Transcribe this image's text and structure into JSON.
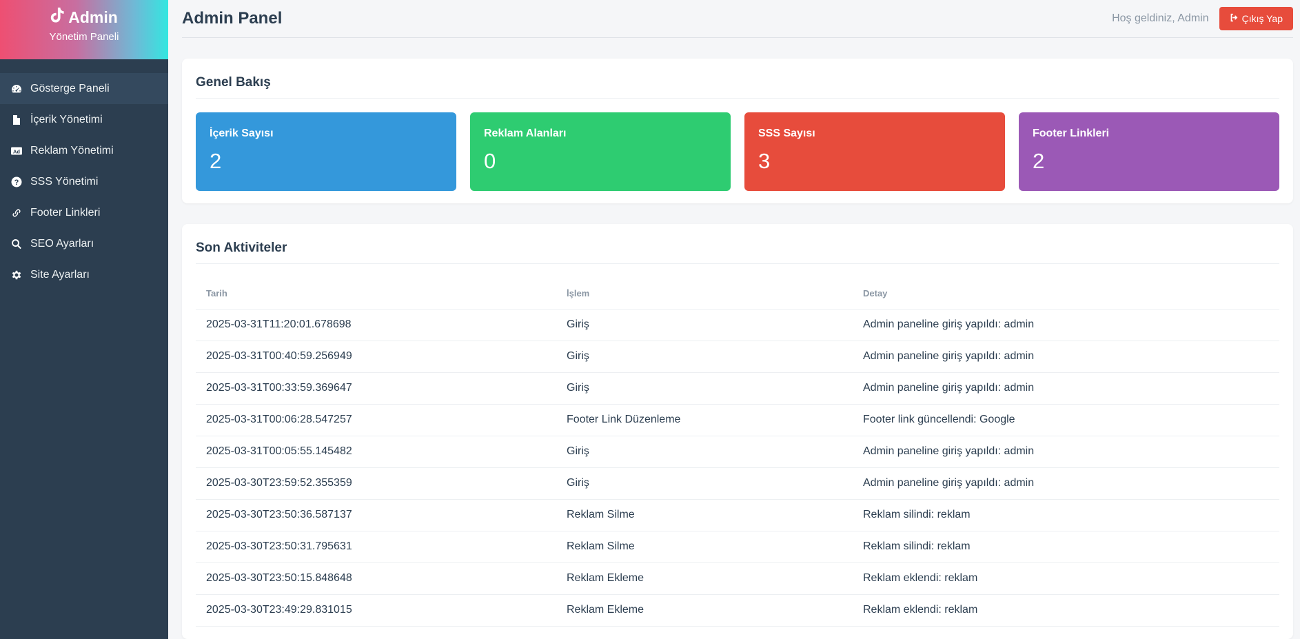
{
  "sidebar": {
    "brand_title": "Admin",
    "brand_subtitle": "Yönetim Paneli",
    "items": [
      {
        "label": "Gösterge Paneli",
        "icon": "gauge-icon",
        "active": true
      },
      {
        "label": "İçerik Yönetimi",
        "icon": "file-icon"
      },
      {
        "label": "Reklam Yönetimi",
        "icon": "ad-icon"
      },
      {
        "label": "SSS Yönetimi",
        "icon": "question-icon"
      },
      {
        "label": "Footer Linkleri",
        "icon": "link-icon"
      },
      {
        "label": "SEO Ayarları",
        "icon": "search-icon"
      },
      {
        "label": "Site Ayarları",
        "icon": "gear-icon"
      }
    ]
  },
  "header": {
    "title": "Admin Panel",
    "welcome": "Hoş geldiniz, Admin",
    "logout_label": "Çıkış Yap"
  },
  "overview": {
    "title": "Genel Bakış",
    "stats": [
      {
        "label": "İçerik Sayısı",
        "value": "2",
        "color": "#3498db"
      },
      {
        "label": "Reklam Alanları",
        "value": "0",
        "color": "#2ecc71"
      },
      {
        "label": "SSS Sayısı",
        "value": "3",
        "color": "#e74c3c"
      },
      {
        "label": "Footer Linkleri",
        "value": "2",
        "color": "#9b59b6"
      }
    ]
  },
  "activity": {
    "title": "Son Aktiviteler",
    "columns": [
      "Tarih",
      "İşlem",
      "Detay"
    ],
    "rows": [
      [
        "2025-03-31T11:20:01.678698",
        "Giriş",
        "Admin paneline giriş yapıldı: admin"
      ],
      [
        "2025-03-31T00:40:59.256949",
        "Giriş",
        "Admin paneline giriş yapıldı: admin"
      ],
      [
        "2025-03-31T00:33:59.369647",
        "Giriş",
        "Admin paneline giriş yapıldı: admin"
      ],
      [
        "2025-03-31T00:06:28.547257",
        "Footer Link Düzenleme",
        "Footer link güncellendi: Google"
      ],
      [
        "2025-03-31T00:05:55.145482",
        "Giriş",
        "Admin paneline giriş yapıldı: admin"
      ],
      [
        "2025-03-30T23:59:52.355359",
        "Giriş",
        "Admin paneline giriş yapıldı: admin"
      ],
      [
        "2025-03-30T23:50:36.587137",
        "Reklam Silme",
        "Reklam silindi: reklam"
      ],
      [
        "2025-03-30T23:50:31.795631",
        "Reklam Silme",
        "Reklam silindi: reklam"
      ],
      [
        "2025-03-30T23:50:15.848648",
        "Reklam Ekleme",
        "Reklam eklendi: reklam"
      ],
      [
        "2025-03-30T23:49:29.831015",
        "Reklam Ekleme",
        "Reklam eklendi: reklam"
      ]
    ]
  }
}
